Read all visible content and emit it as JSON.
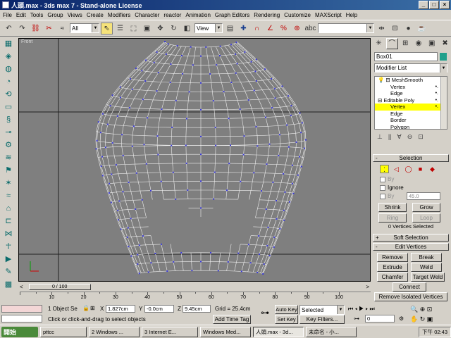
{
  "window": {
    "title": "人頭.max - 3ds max 7   - Stand-alone License"
  },
  "menu": [
    "File",
    "Edit",
    "Tools",
    "Group",
    "Views",
    "Create",
    "Modifiers",
    "Character",
    "reactor",
    "Animation",
    "Graph Editors",
    "Rendering",
    "Customize",
    "MAXScript",
    "Help"
  ],
  "toolbar": {
    "selection_filter": "All",
    "ref_coord": "View"
  },
  "viewport": {
    "label": "Front"
  },
  "command_panel": {
    "object_name": "Box01",
    "object_color": "#1fa08c",
    "modifier_list": "Modifier List",
    "stack": [
      {
        "label": "MeshSmooth"
      },
      {
        "label": "Vertex"
      },
      {
        "label": "Edge"
      },
      {
        "label": "Editable Poly"
      },
      {
        "label": "Vertex"
      },
      {
        "label": "Edge"
      },
      {
        "label": "Border"
      },
      {
        "label": "Polygon"
      }
    ],
    "selection": {
      "title": "Selection",
      "by_vertex": "By",
      "ignore_backfacing": "Ignore",
      "by_angle": "By",
      "angle_value": "45.0",
      "shrink": "Shrink",
      "grow": "Grow",
      "ring": "Ring",
      "loop": "Loop",
      "status": "0 Vertices Selected"
    },
    "soft_selection": {
      "title": "Soft Selection"
    },
    "edit_vertices": {
      "title": "Edit Vertices",
      "remove": "Remove",
      "break": "Break",
      "extrude": "Extrude",
      "weld": "Weld",
      "chamfer": "Chamfer",
      "target_weld": "Target Weld",
      "connect": "Connect",
      "remove_isolated": "Remove Isolated Vertices"
    }
  },
  "timeslider": {
    "label": "0 / 100"
  },
  "ruler_ticks": [
    "10",
    "20",
    "30",
    "40",
    "50",
    "60",
    "70",
    "80",
    "90",
    "100"
  ],
  "status": {
    "selected": "1 Object Se",
    "x_label": "X",
    "x_value": "1.827cm",
    "y_label": "Y",
    "y_value": "-0.0cm",
    "z_label": "Z",
    "z_value": "9.45cm",
    "grid": "Grid = 25.4cm",
    "auto_key": "Auto Key",
    "set_key": "Set Key",
    "selected_dropdown": "Selected",
    "key_filters": "Key Filters...",
    "prompt": "Click or click-and-drag to select objects",
    "add_time_tag": "Add Time Tag",
    "frame": "0"
  },
  "taskbar": {
    "start": "開始",
    "tasks": [
      "pttcc",
      "2 Windows ...",
      "3 Internet E...",
      "Windows Med...",
      "人頭.max - 3d...",
      "未命名 - 小..."
    ],
    "clock": "下午 02:43"
  }
}
